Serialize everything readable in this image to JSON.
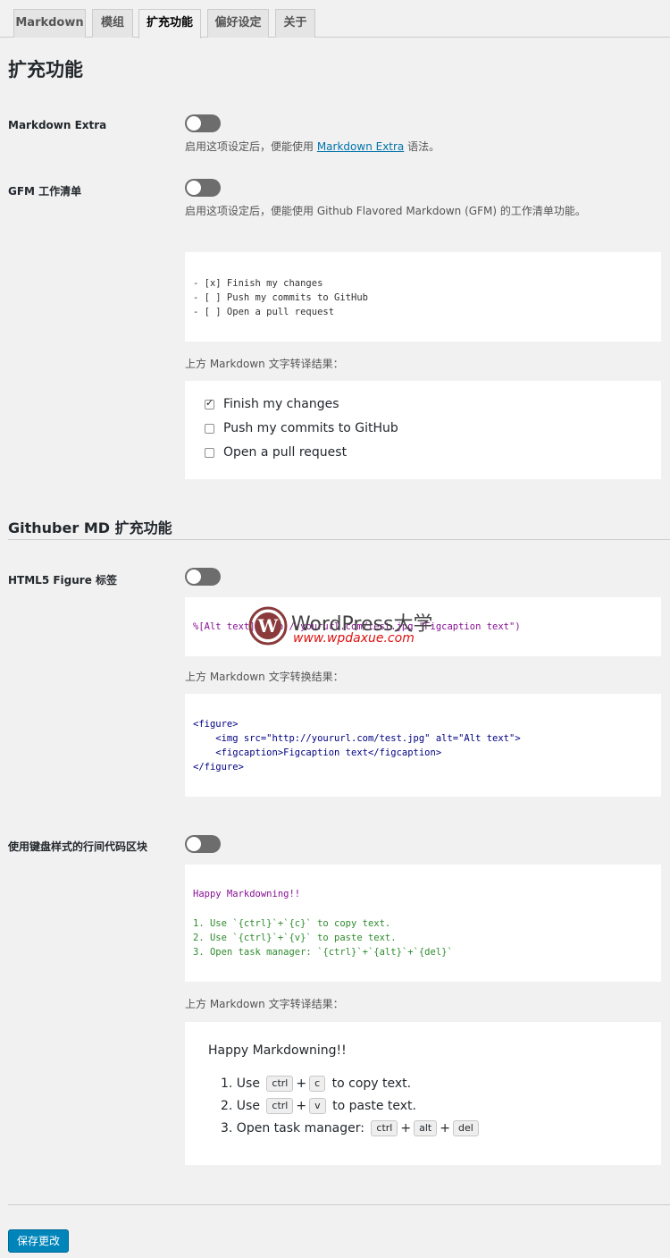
{
  "tabs": [
    "Markdown",
    "模组",
    "扩充功能",
    "偏好设定",
    "关于"
  ],
  "page_title": "扩充功能",
  "settings": {
    "md_extra": {
      "label": "Markdown Extra",
      "desc_prefix": "启用这项设定后，便能使用 ",
      "link": "Markdown Extra",
      "desc_suffix": " 语法。"
    },
    "gfm": {
      "label": "GFM 工作清单",
      "desc": "启用这项设定后，便能使用 Github Flavored Markdown (GFM) 的工作清单功能。",
      "code": [
        "- [x] Finish my changes",
        "- [ ] Push my commits to GitHub",
        "- [ ] Open a pull request"
      ],
      "result_label": "上方 Markdown 文字转译结果：",
      "tasks": [
        {
          "text": "Finish my changes",
          "checked": true
        },
        {
          "text": "Push my commits to GitHub",
          "checked": false
        },
        {
          "text": "Open a pull request",
          "checked": false
        }
      ]
    }
  },
  "section2_title": "Githuber MD 扩充功能",
  "figure": {
    "label": "HTML5 Figure 标签",
    "code": "%[Alt text](http://yoururl.com/test.jpg \"Figcaption text\")",
    "result_label": "上方 Markdown 文字转换结果：",
    "html_lines": [
      "<figure>",
      "    <img src=\"http://yoururl.com/test.jpg\" alt=\"Alt text\">",
      "    <figcaption>Figcaption text</figcaption>",
      "</figure>"
    ]
  },
  "kbd": {
    "label": "使用键盘样式的行间代码区块",
    "code_title": "Happy Markdowning!!",
    "code_lines": [
      "1. Use `{ctrl}`+`{c}` to copy text.",
      "2. Use `{ctrl}`+`{v}` to paste text.",
      "3. Open task manager: `{ctrl}`+`{alt}`+`{del}`"
    ],
    "result_label": "上方 Markdown 文字转译结果：",
    "render_title": "Happy Markdowning!!",
    "render_items": [
      {
        "prefix": "1. Use",
        "keys": [
          "ctrl",
          "c"
        ],
        "suffix": "to copy text."
      },
      {
        "prefix": "2. Use",
        "keys": [
          "ctrl",
          "v"
        ],
        "suffix": "to paste text."
      },
      {
        "prefix": "3. Open task manager:",
        "keys": [
          "ctrl",
          "alt",
          "del"
        ],
        "suffix": ""
      }
    ]
  },
  "watermark": {
    "title": "WordPress大学",
    "subtitle": "www.wpdaxue.com"
  },
  "save_button": "保存更改"
}
